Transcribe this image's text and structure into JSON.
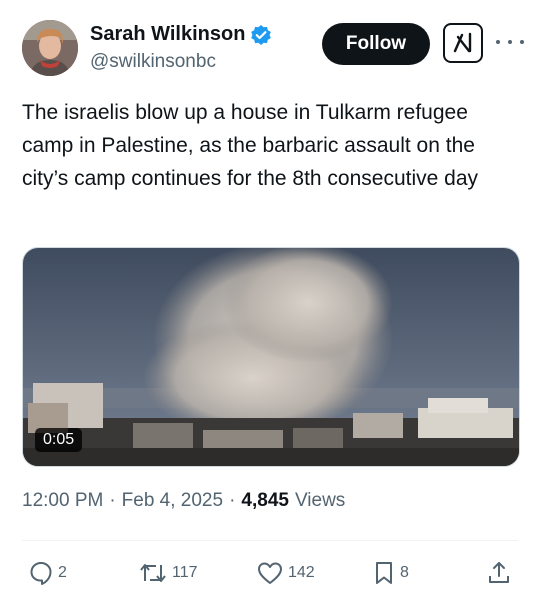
{
  "author": {
    "name": "Sarah Wilkinson",
    "handle": "@swilkinsonbc",
    "verified": true
  },
  "header": {
    "follow_label": "Follow",
    "grok_icon": "grok-icon",
    "more_icon": "more-icon"
  },
  "tweet": {
    "text": "The israelis blow up a house in Tulkarm refugee camp in Palestine, as the barbaric assault on the city’s camp continues for the 8th consecutive day"
  },
  "media": {
    "type": "video",
    "duration": "0:05"
  },
  "meta": {
    "time": "12:00 PM",
    "separator": "·",
    "date": "Feb 4, 2025",
    "views_count": "4,845",
    "views_label": "Views"
  },
  "actions": {
    "replies": "2",
    "reposts": "117",
    "likes": "142",
    "bookmarks": "8"
  },
  "colors": {
    "text_primary": "#0f1419",
    "text_secondary": "#536471",
    "verified_blue": "#1d9bf0",
    "divider": "#eff3f4"
  }
}
